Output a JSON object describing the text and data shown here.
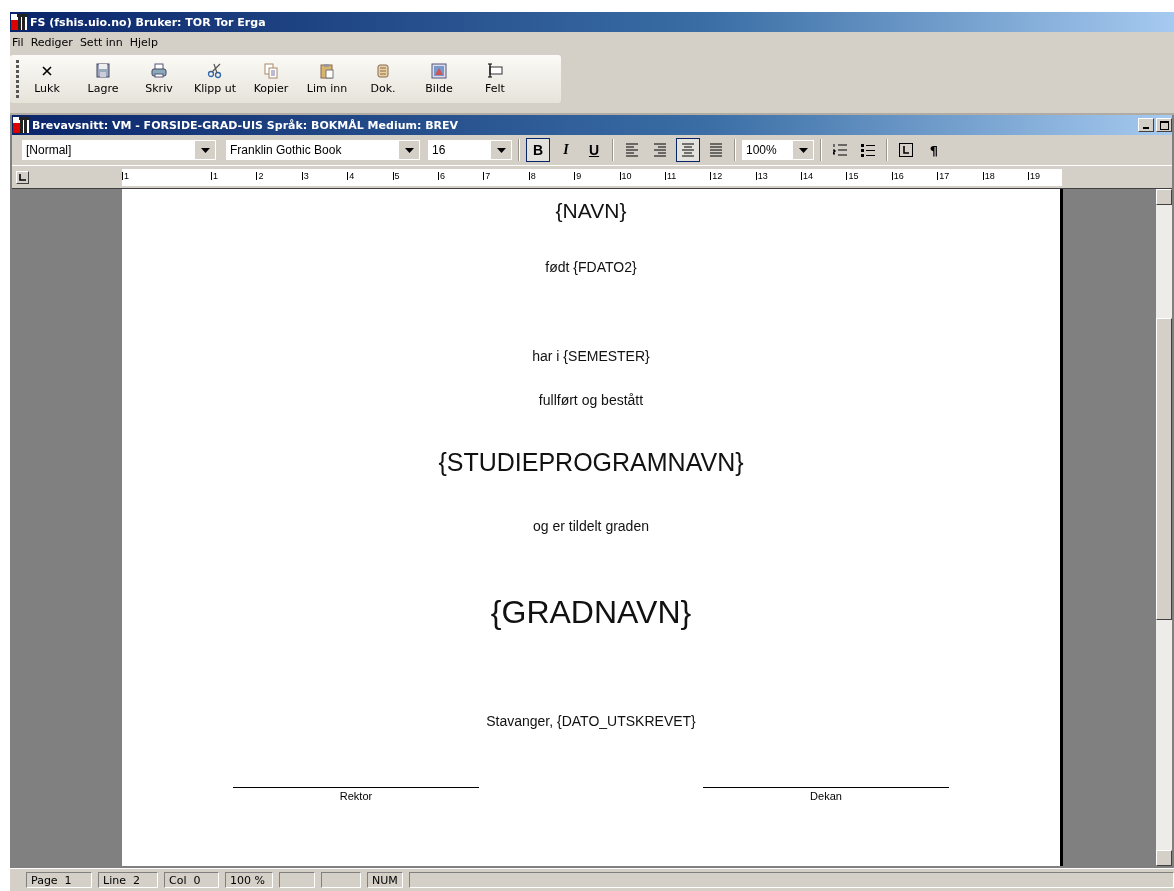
{
  "app_window": {
    "title": "FS (fshis.uio.no) Bruker: TOR Tor Erga"
  },
  "menu": [
    "Fil",
    "Rediger",
    "Sett inn",
    "Hjelp"
  ],
  "toolbar": [
    {
      "label": "Lukk",
      "kind": "close"
    },
    {
      "label": "Lagre",
      "kind": "save"
    },
    {
      "label": "Skriv",
      "kind": "print"
    },
    {
      "label": "Klipp ut",
      "kind": "cut"
    },
    {
      "label": "Kopier",
      "kind": "copy"
    },
    {
      "label": "Lim inn",
      "kind": "paste"
    },
    {
      "label": "Dok.",
      "kind": "doc"
    },
    {
      "label": "Bilde",
      "kind": "image"
    },
    {
      "label": "Felt",
      "kind": "field"
    }
  ],
  "doc_window": {
    "title": "Brevavsnitt: VM - FORSIDE-GRAD-UIS Språk: BOKMÅL Medium: BREV"
  },
  "format_bar": {
    "style": "[Normal]",
    "font": "Franklin Gothic Book",
    "size": "16",
    "text_buttons": [
      {
        "label": "B",
        "kind": "bold",
        "selected": true
      },
      {
        "label": "I",
        "kind": "italic",
        "selected": false
      },
      {
        "label": "U",
        "kind": "underline",
        "selected": false
      }
    ],
    "align_buttons": [
      {
        "kind": "left",
        "selected": false
      },
      {
        "kind": "right",
        "selected": false
      },
      {
        "kind": "center",
        "selected": true
      },
      {
        "kind": "justify",
        "selected": false
      }
    ],
    "zoom": "100%",
    "pilcrow": "¶"
  },
  "ruler": [
    "1",
    "1",
    "2",
    "3",
    "4",
    "5",
    "6",
    "7",
    "8",
    "9",
    "10",
    "11",
    "12",
    "13",
    "14",
    "15",
    "16",
    "17",
    "18",
    "19"
  ],
  "document": [
    {
      "text": "{NAVN}",
      "kind": "h3"
    },
    {
      "text": "født {FDATO2}",
      "kind": "body"
    },
    {
      "text": "har i {SEMESTER}",
      "kind": "body"
    },
    {
      "text": "fullført og bestått",
      "kind": "body"
    },
    {
      "text": "{STUDIEPROGRAMNAVN}",
      "kind": "h2"
    },
    {
      "text": "og er tildelt graden",
      "kind": "body"
    },
    {
      "text": "{GRADNAVN}",
      "kind": "h1"
    },
    {
      "text": "Stavanger, {DATO_UTSKREVET}",
      "kind": "body"
    }
  ],
  "signatures": [
    "Rektor",
    "Dekan"
  ],
  "status_bar": [
    {
      "kind": "text",
      "text": "Page  1"
    },
    {
      "kind": "text",
      "text": "Line  2"
    },
    {
      "kind": "text",
      "text": "Col  0"
    },
    {
      "kind": "text",
      "text": "100 %"
    },
    {
      "kind": "blank"
    },
    {
      "kind": "blank"
    },
    {
      "kind": "text",
      "text": "NUM"
    },
    {
      "kind": "blank"
    }
  ]
}
